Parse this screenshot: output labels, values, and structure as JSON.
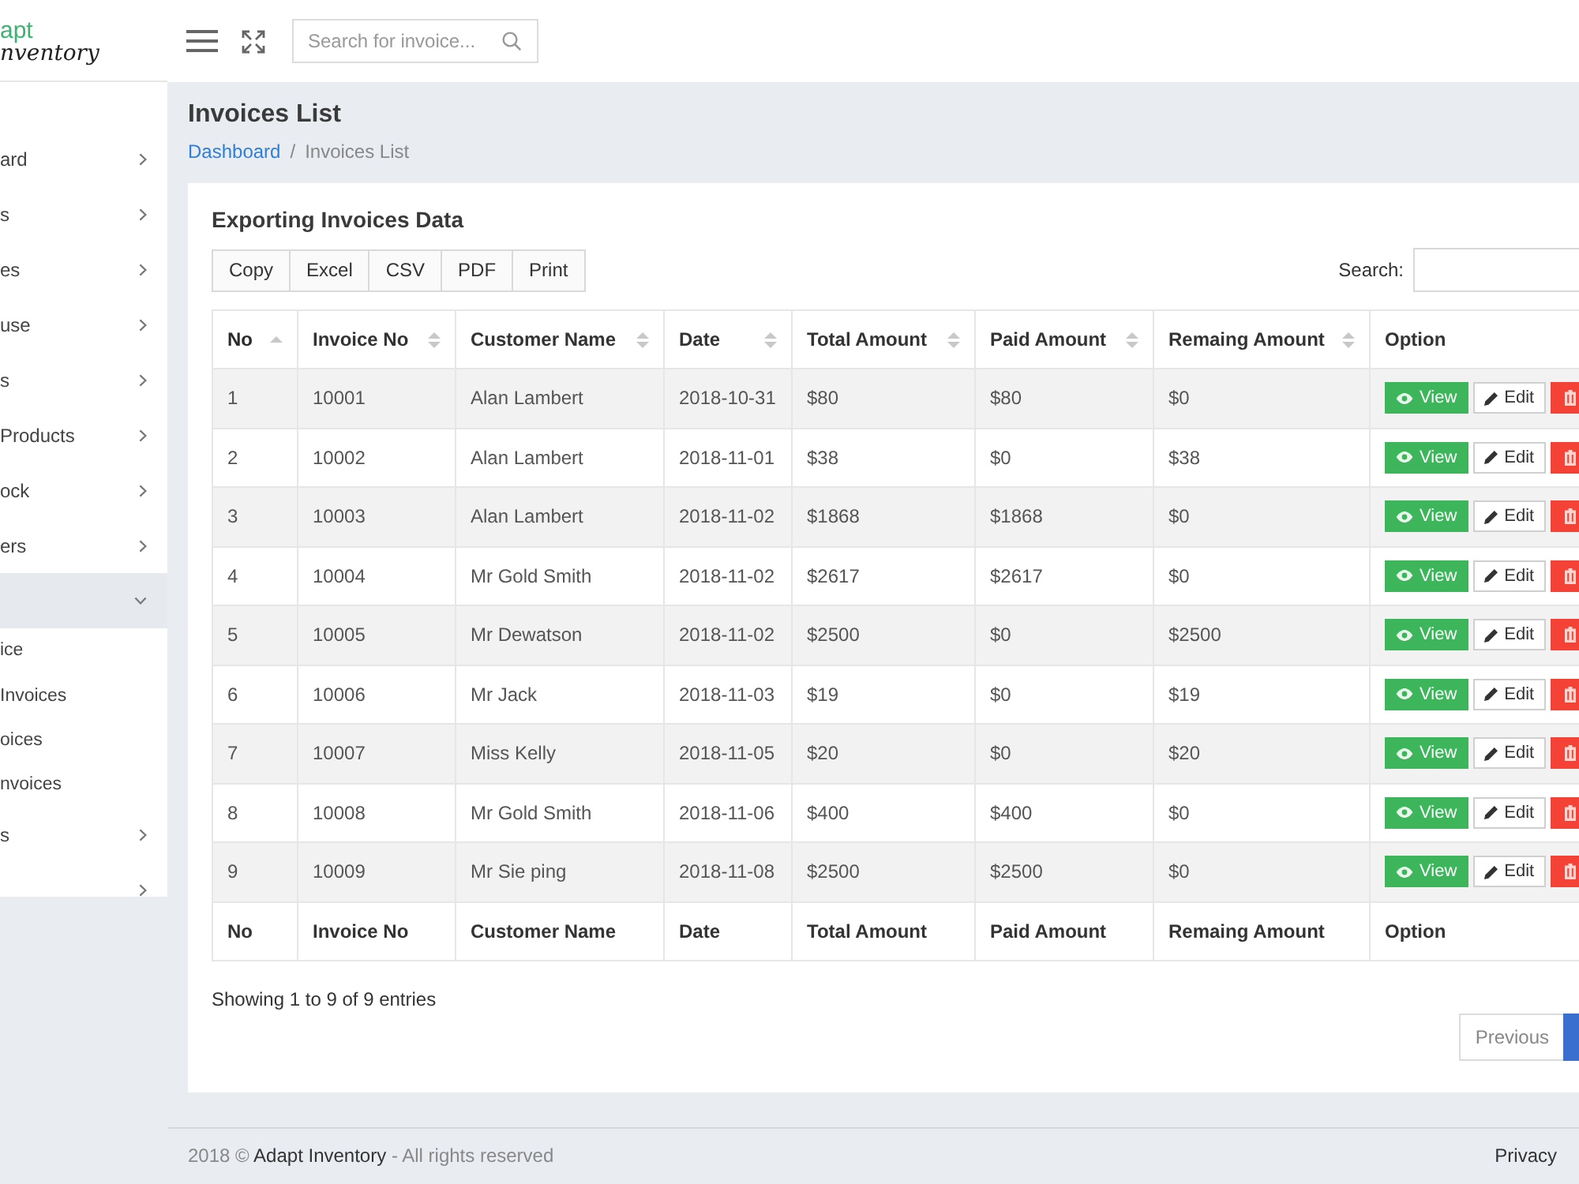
{
  "header": {
    "logo": {
      "line_1": "apt",
      "line_2": "nventory"
    },
    "search": {
      "placeholder": "Search for invoice..."
    }
  },
  "sidebar": {
    "items": [
      {
        "label": "ard",
        "selected": false,
        "expanded": false
      },
      {
        "label": "s",
        "selected": false,
        "expanded": false
      },
      {
        "label": "es",
        "selected": false,
        "expanded": false
      },
      {
        "label": "use",
        "selected": false,
        "expanded": false
      },
      {
        "label": "s",
        "selected": false,
        "expanded": false
      },
      {
        "label": "Products",
        "selected": false,
        "expanded": false
      },
      {
        "label": "ock",
        "selected": false,
        "expanded": false
      },
      {
        "label": "ers",
        "selected": false,
        "expanded": false
      },
      {
        "selected": true,
        "expanded": true,
        "children": [
          {
            "label": "ice",
            "selected": false
          },
          {
            "label": "Invoices",
            "selected": false
          },
          {
            "label": "oices",
            "selected": false
          },
          {
            "label": "nvoices",
            "selected": false
          }
        ]
      },
      {
        "label": "s",
        "selected": false,
        "expanded": false
      },
      {
        "selected": false,
        "expanded": false
      }
    ]
  },
  "page": {
    "title": "Invoices List",
    "breadcrumb": {
      "items": [
        {
          "kind": "link",
          "label": "Dashboard"
        },
        {
          "kind": "current",
          "label": "Invoices List"
        }
      ],
      "separator": "/"
    }
  },
  "card": {
    "title": "Exporting Invoices Data",
    "export_buttons": [
      "Copy",
      "Excel",
      "CSV",
      "PDF",
      "Print"
    ],
    "search_label": "Search:",
    "table": {
      "columns": [
        {
          "label": "No",
          "sortable": true,
          "sorted": true
        },
        {
          "label": "Invoice No",
          "sortable": true,
          "sorted": false
        },
        {
          "label": "Customer Name",
          "sortable": true,
          "sorted": false
        },
        {
          "label": "Date",
          "sortable": true,
          "sorted": false
        },
        {
          "label": "Total Amount",
          "sortable": true,
          "sorted": false
        },
        {
          "label": "Paid Amount",
          "sortable": true,
          "sorted": false
        },
        {
          "label": "Remaing Amount",
          "sortable": true,
          "sorted": false
        },
        {
          "label": "Option"
        }
      ],
      "rows": [
        {
          "cells": [
            "1",
            "10001",
            "Alan Lambert",
            "2018-10-31",
            "$80",
            "$80",
            "$0"
          ],
          "actions": [
            {
              "kind": "view",
              "label": "View"
            },
            {
              "kind": "edit",
              "label": "Edit"
            },
            {
              "kind": "delete"
            }
          ]
        },
        {
          "cells": [
            "2",
            "10002",
            "Alan Lambert",
            "2018-11-01",
            "$38",
            "$0",
            "$38"
          ],
          "actions": [
            {
              "kind": "view",
              "label": "View"
            },
            {
              "kind": "edit",
              "label": "Edit"
            },
            {
              "kind": "delete"
            }
          ]
        },
        {
          "cells": [
            "3",
            "10003",
            "Alan Lambert",
            "2018-11-02",
            "$1868",
            "$1868",
            "$0"
          ],
          "actions": [
            {
              "kind": "view",
              "label": "View"
            },
            {
              "kind": "edit",
              "label": "Edit"
            },
            {
              "kind": "delete"
            }
          ]
        },
        {
          "cells": [
            "4",
            "10004",
            "Mr Gold Smith",
            "2018-11-02",
            "$2617",
            "$2617",
            "$0"
          ],
          "actions": [
            {
              "kind": "view",
              "label": "View"
            },
            {
              "kind": "edit",
              "label": "Edit"
            },
            {
              "kind": "delete"
            }
          ]
        },
        {
          "cells": [
            "5",
            "10005",
            "Mr Dewatson",
            "2018-11-02",
            "$2500",
            "$0",
            "$2500"
          ],
          "actions": [
            {
              "kind": "view",
              "label": "View"
            },
            {
              "kind": "edit",
              "label": "Edit"
            },
            {
              "kind": "delete"
            }
          ]
        },
        {
          "cells": [
            "6",
            "10006",
            "Mr Jack",
            "2018-11-03",
            "$19",
            "$0",
            "$19"
          ],
          "actions": [
            {
              "kind": "view",
              "label": "View"
            },
            {
              "kind": "edit",
              "label": "Edit"
            },
            {
              "kind": "delete"
            }
          ]
        },
        {
          "cells": [
            "7",
            "10007",
            "Miss Kelly",
            "2018-11-05",
            "$20",
            "$0",
            "$20"
          ],
          "actions": [
            {
              "kind": "view",
              "label": "View"
            },
            {
              "kind": "edit",
              "label": "Edit"
            },
            {
              "kind": "delete"
            }
          ]
        },
        {
          "cells": [
            "8",
            "10008",
            "Mr Gold Smith",
            "2018-11-06",
            "$400",
            "$400",
            "$0"
          ],
          "actions": [
            {
              "kind": "view",
              "label": "View"
            },
            {
              "kind": "edit",
              "label": "Edit"
            },
            {
              "kind": "delete"
            }
          ]
        },
        {
          "cells": [
            "9",
            "10009",
            "Mr Sie ping",
            "2018-11-08",
            "$2500",
            "$2500",
            "$0"
          ],
          "actions": [
            {
              "kind": "view",
              "label": "View"
            },
            {
              "kind": "edit",
              "label": "Edit"
            },
            {
              "kind": "delete"
            }
          ]
        }
      ],
      "footer": [
        "No",
        "Invoice No",
        "Customer Name",
        "Date",
        "Total Amount",
        "Paid Amount",
        "Remaing Amount",
        "Option"
      ]
    },
    "info": "Showing 1 to 9 of 9 entries",
    "pagination": {
      "previous": {
        "label": "Previous",
        "disabled": true
      },
      "pages": [
        {
          "selected": true
        }
      ]
    }
  },
  "footer": {
    "copyright": "2018 ©",
    "link": "Adapt Inventory",
    "rights": "- All rights reserved",
    "privacy": "Privacy"
  }
}
